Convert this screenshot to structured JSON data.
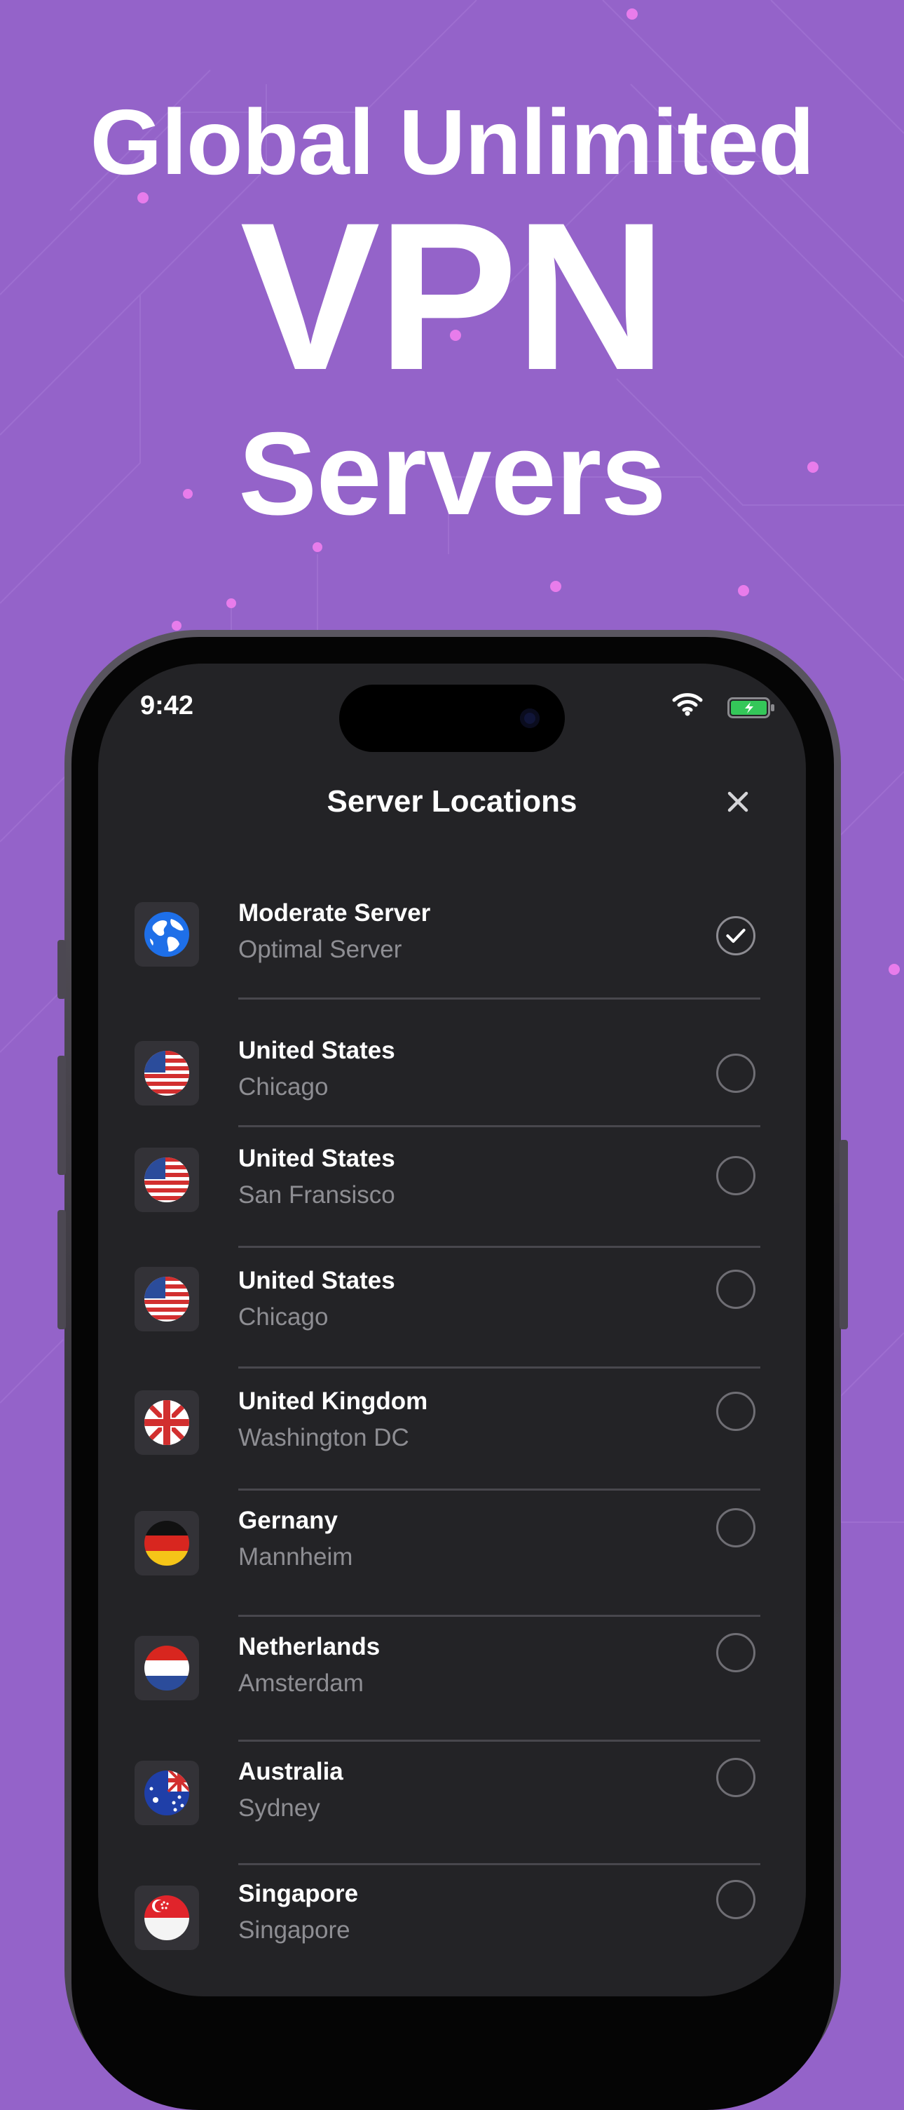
{
  "hero": {
    "line1": "Global Unlimited",
    "line2": "VPN",
    "line3": "Servers"
  },
  "status_bar": {
    "time": "9:42"
  },
  "header": {
    "title": "Server Locations",
    "close_icon": "close-icon"
  },
  "servers": [
    {
      "name": "Moderate Server",
      "city": "Optimal Server",
      "flag": "globe-icon",
      "selected": true
    },
    {
      "name": "United States",
      "city": "Chicago",
      "flag": "us-flag-icon",
      "selected": false
    },
    {
      "name": "United States",
      "city": "San Fransisco",
      "flag": "us-flag-icon",
      "selected": false
    },
    {
      "name": "United States",
      "city": "Chicago",
      "flag": "us-flag-icon",
      "selected": false
    },
    {
      "name": "United Kingdom",
      "city": "Washington DC",
      "flag": "uk-flag-icon",
      "selected": false
    },
    {
      "name": "Gernany",
      "city": "Mannheim",
      "flag": "germany-flag-icon",
      "selected": false
    },
    {
      "name": "Netherlands",
      "city": "Amsterdam",
      "flag": "netherlands-flag-icon",
      "selected": false
    },
    {
      "name": "Australia",
      "city": "Sydney",
      "flag": "australia-flag-icon",
      "selected": false
    },
    {
      "name": "Singapore",
      "city": "Singapore",
      "flag": "singapore-flag-icon",
      "selected": false
    }
  ],
  "colors": {
    "background": "#9463C9",
    "screen": "#232326",
    "flag_tile": "#333237",
    "subtitle": "#8e8e93",
    "battery": "#34C759"
  }
}
